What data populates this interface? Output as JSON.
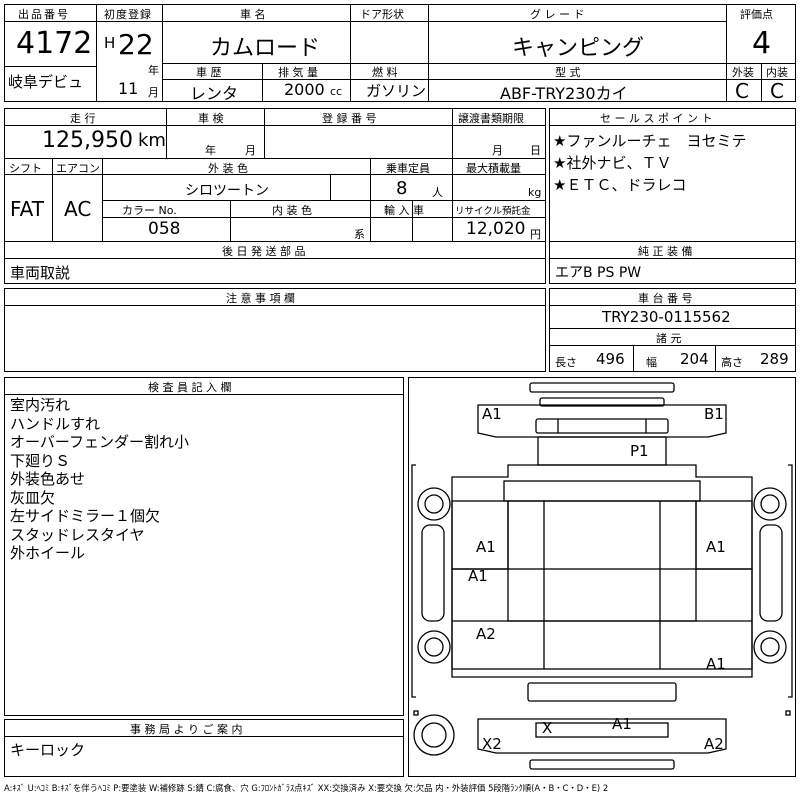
{
  "header": {
    "lot_label": "出品番号",
    "lot_value": "4172",
    "venue": "岐阜デビュ",
    "reg_label": "初度登録",
    "era": "H",
    "year": "22",
    "year_unit": "年",
    "month": "11",
    "month_unit": "月",
    "name_label": "車 名",
    "name_value": "カムロード",
    "door_label": "ドア形状",
    "door_value": "",
    "grade_label": "グ レ ー ド",
    "grade_value": "キャンピング",
    "score_label": "評価点",
    "score_value": "4",
    "history_label": "車 歴",
    "history_value": "レンタ",
    "displacement_label": "排 気 量",
    "displacement_value": "2000",
    "displacement_unit": "cc",
    "fuel_label": "燃 料",
    "fuel_value": "ガソリン",
    "model_label": "型 式",
    "model_value": "ABF-TRY230カイ",
    "ext_label": "外装",
    "ext_value": "C",
    "int_label": "内装",
    "int_value": "C"
  },
  "mid": {
    "mileage_label": "走 行",
    "mileage_value": "125,950",
    "mileage_unit": "km",
    "inspection_label": "車 検",
    "inspection_year": "年",
    "inspection_month": "月",
    "regnum_label": "登 録 番 号",
    "regnum_value": "",
    "transfer_label": "譲渡書類期限",
    "transfer_month": "月",
    "transfer_day": "日",
    "shift_label": "シフト",
    "shift_value": "FAT",
    "ac_label": "エアコン",
    "ac_value": "AC",
    "color_label": "外 装 色",
    "color_value": "シロツートン",
    "capacity_label": "乗車定員",
    "capacity_value": "8",
    "capacity_unit": "人",
    "load_label": "最大積載量",
    "load_unit": "kg",
    "colorno_label": "カラー No.",
    "colorno_value": "058",
    "intcolor_label": "内 装 色",
    "intcolor_unit": "系",
    "import_label": "輸 入 車",
    "recycle_label": "リサイクル預託金",
    "recycle_value": "12,020",
    "recycle_unit": "円",
    "later_label": "後 日 発 送 部 品",
    "later_value": "車両取説",
    "notes_label": "注 意 事 項 欄",
    "notes_value": ""
  },
  "sales": {
    "label": "セ ー ル ス ポ イ ン ト",
    "points": [
      "★ファンルーチェ　ヨセミテ",
      "★社外ナビ、ＴＶ",
      "★ＥＴＣ、ドラレコ"
    ]
  },
  "equip": {
    "label": "純 正 装 備",
    "value": "エアB PS PW"
  },
  "chassis": {
    "label": "車 台 番 号",
    "value": "TRY230-0115562"
  },
  "dims": {
    "label": "諸 元",
    "length_label": "長さ",
    "length": "496",
    "width_label": "幅",
    "width": "204",
    "height_label": "高さ",
    "height": "289"
  },
  "inspector": {
    "label": "検 査 員 記 入 欄",
    "lines": [
      "室内汚れ",
      "ハンドルすれ",
      "オーバーフェンダー割れ小",
      "下廻りＳ",
      "外装色あせ",
      "灰皿欠",
      "左サイドミラー１個欠",
      "スタッドレスタイヤ",
      "外ホイール"
    ]
  },
  "office": {
    "label": "事 務 局 よ り ご 案 内",
    "value": "キーロック"
  },
  "diagram": {
    "marks": [
      "A1",
      "B1",
      "P1",
      "A1",
      "A1",
      "A1",
      "A2",
      "A1",
      "X",
      "A1",
      "X2",
      "A2"
    ]
  },
  "legend": "A:ｷｽﾞ U:ﾍｺﾐ B:ｷｽﾞを伴うﾍｺﾐ P:要塗装 W:補修跡 S:錆 C:腐食、穴 G:ﾌﾛﾝﾄｶﾞﾗｽ点ｷｽﾞ XX:交換済み X:要交換 欠:欠品 内・外装評価 5段階ﾗﾝｸ順(A・B・C・D・E) 2"
}
